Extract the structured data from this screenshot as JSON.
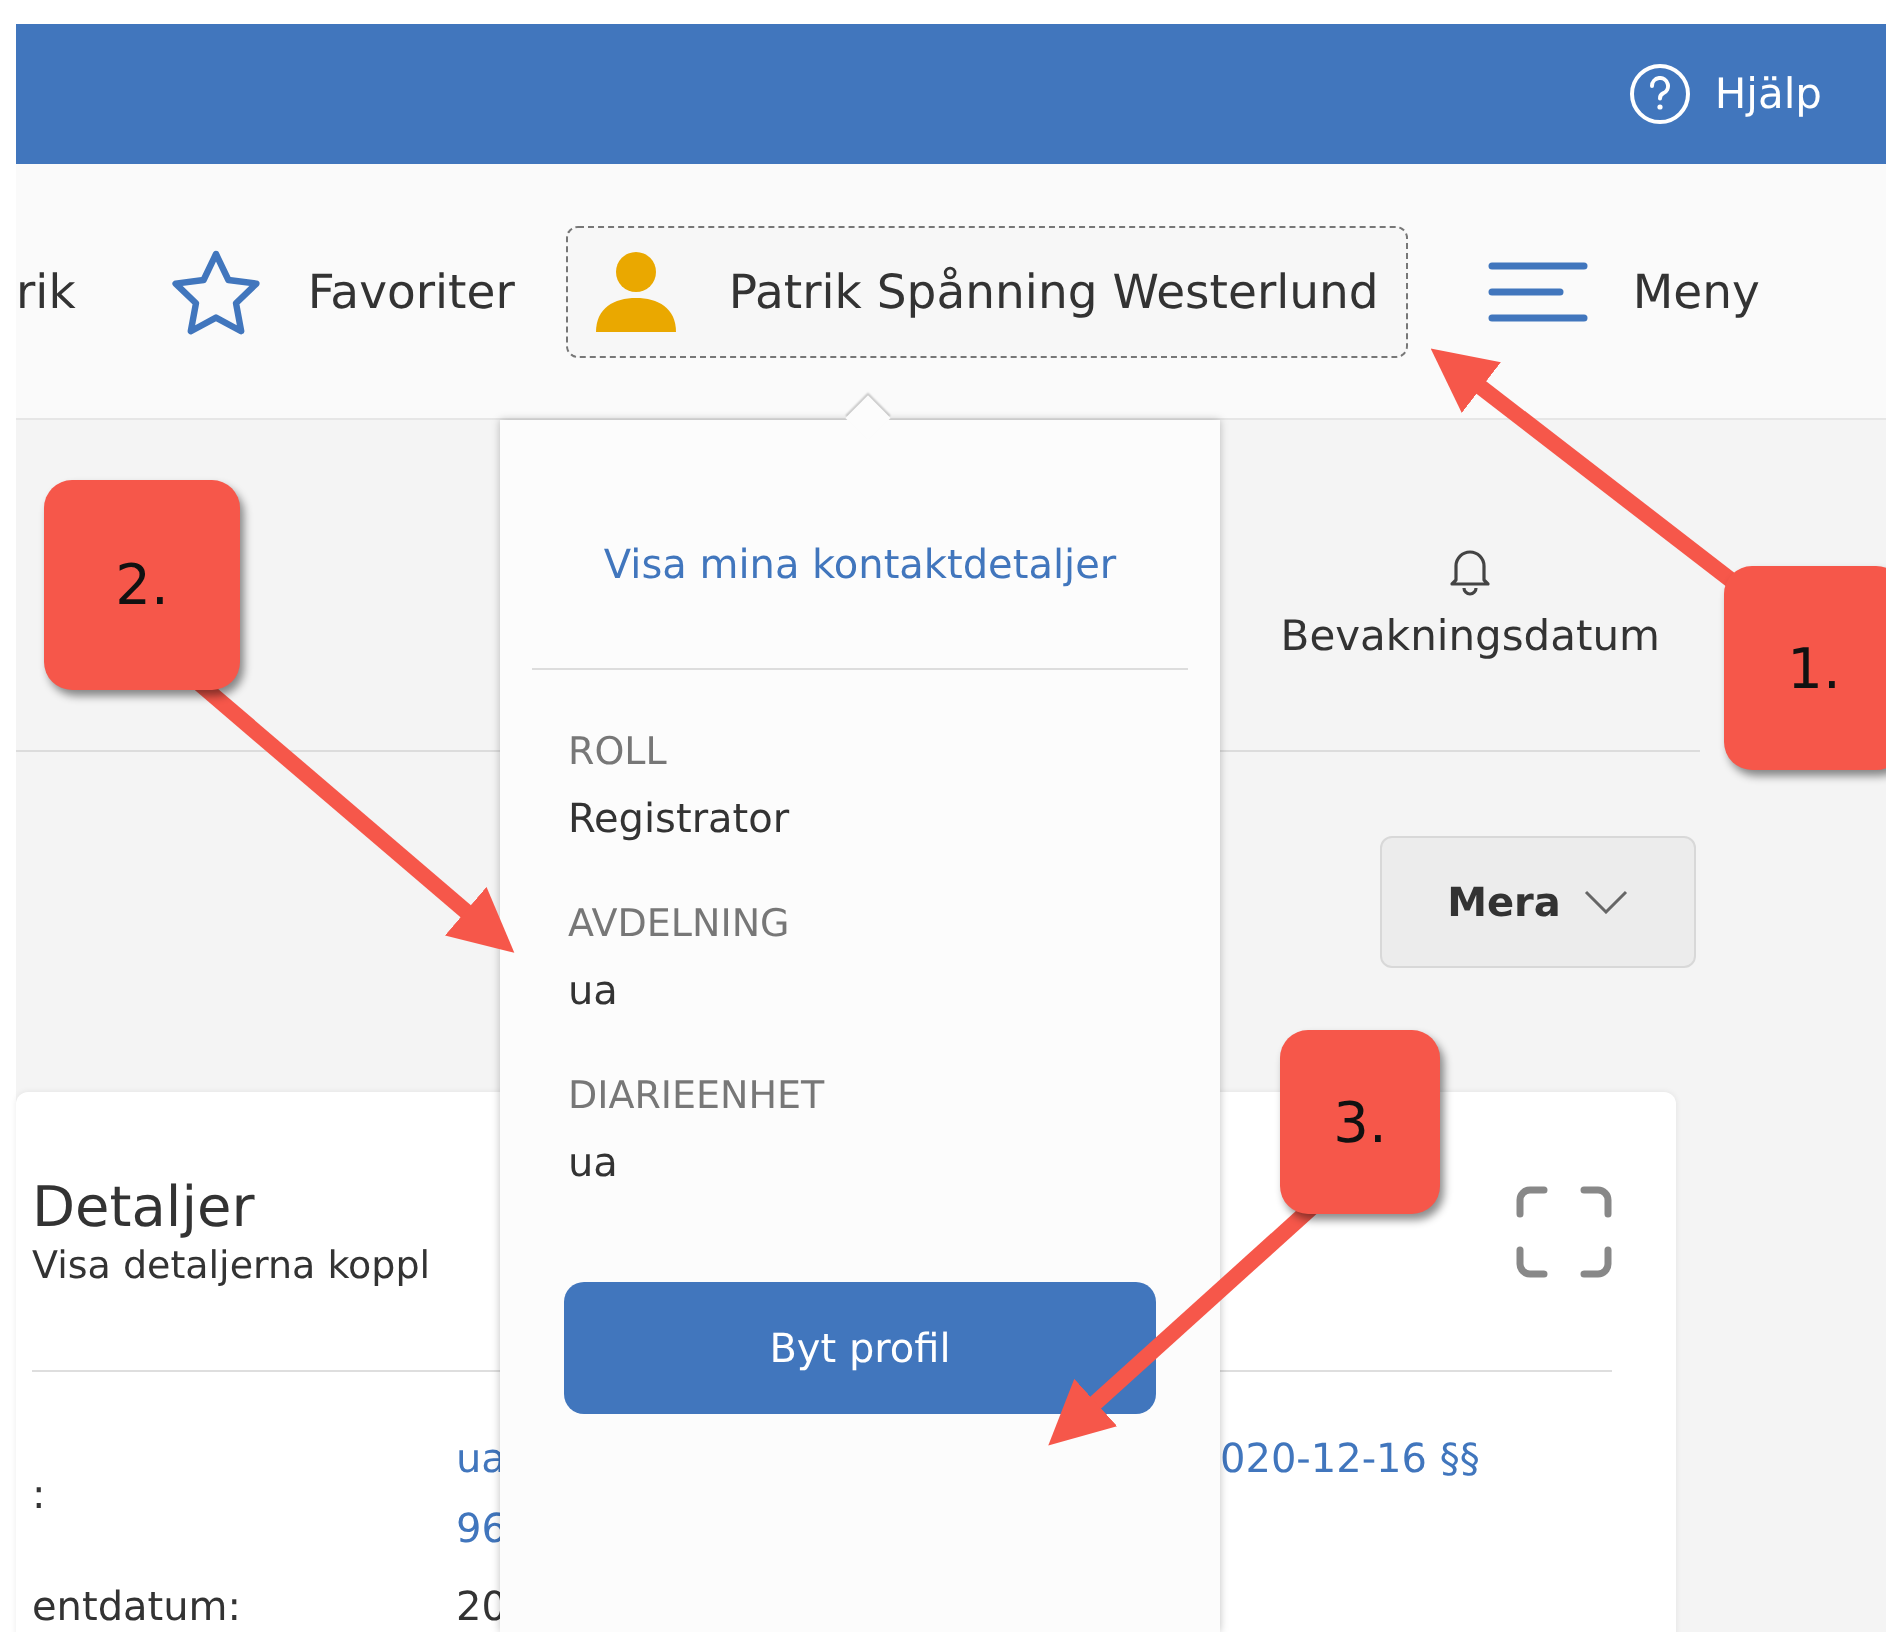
{
  "header": {
    "help_label": "Hjälp"
  },
  "toolbar": {
    "items": [
      {
        "kind": "link",
        "label": "rik"
      },
      {
        "kind": "favorites",
        "label": "Favoriter"
      },
      {
        "kind": "user",
        "label": "Patrik Spånning Westerlund",
        "expanded": true
      },
      {
        "kind": "menu",
        "label": "Meny"
      }
    ]
  },
  "actions": [
    {
      "label": "Bevakningsdatum"
    }
  ],
  "more_button": {
    "label": "Mera"
  },
  "card": {
    "title": "Detaljer",
    "subtitle": "Visa detaljerna koppl",
    "rows": [
      {
        "label": ":",
        "values": [
          "ua",
          "96"
        ],
        "extra": "020-12-16 §§"
      },
      {
        "label": "entdatum:",
        "values": [
          "20"
        ]
      }
    ]
  },
  "user_menu": {
    "link": "Visa mina kontaktdetaljer",
    "fields": [
      {
        "label": "ROLL",
        "value": "Registrator"
      },
      {
        "label": "AVDELNING",
        "value": "ua"
      },
      {
        "label": "DIARIEENHET",
        "value": "ua"
      }
    ],
    "button": "Byt profil"
  },
  "callouts": [
    {
      "label": "1."
    },
    {
      "label": "2."
    },
    {
      "label": "3."
    }
  ]
}
